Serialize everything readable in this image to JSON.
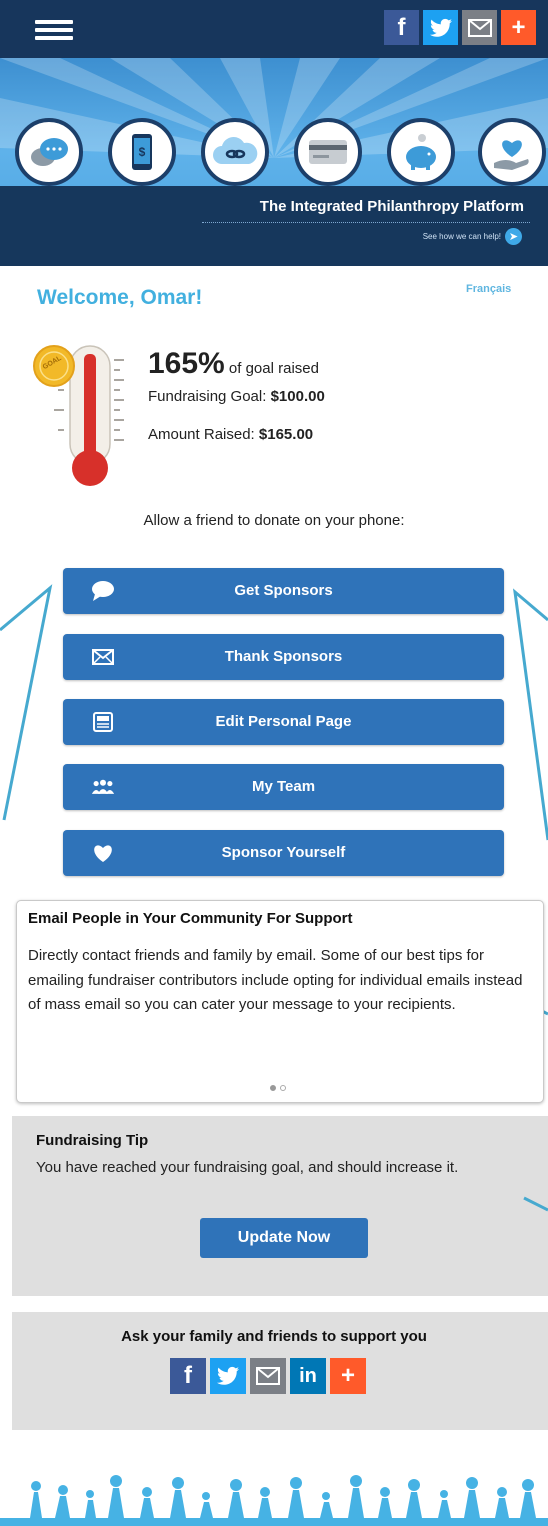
{
  "header": {
    "menu_icon": "hamburger-icon",
    "share_icons": [
      "facebook-icon",
      "twitter-icon",
      "email-icon",
      "plus-icon"
    ]
  },
  "banner": {
    "icons": [
      "chat-bubbles-icon",
      "mobile-phone-icon",
      "cloud-link-icon",
      "credit-card-icon",
      "piggy-bank-icon",
      "heart-hand-icon"
    ],
    "tagline": "The Integrated Philanthropy Platform",
    "see_how": "See how we can help!"
  },
  "welcome": {
    "greeting": "Welcome, Omar!",
    "language_link": "Français"
  },
  "progress": {
    "percent": "165%",
    "percent_suffix": "of goal raised",
    "goal_label": "Fundraising Goal:",
    "goal_value": "$100.00",
    "raised_label": "Amount Raised:",
    "raised_value": "$165.00",
    "fill_fraction": 1.0
  },
  "allow_text": "Allow a friend to donate on your phone:",
  "actions": [
    {
      "label": "Get Sponsors",
      "icon": "speech-bubble-icon"
    },
    {
      "label": "Thank Sponsors",
      "icon": "envelope-icon"
    },
    {
      "label": "Edit Personal Page",
      "icon": "page-icon"
    },
    {
      "label": "My Team",
      "icon": "team-icon"
    },
    {
      "label": "Sponsor Yourself",
      "icon": "heart-icon"
    }
  ],
  "email_card": {
    "title": "Email People in Your Community For Support",
    "body": "Directly contact friends and family by email. Some of our best tips for emailing fundraiser contributors include opting for individual emails instead of mass email so you can cater your message to your recipients.",
    "slides": 2,
    "active_slide": 1
  },
  "tip": {
    "title": "Fundraising Tip",
    "text": "You have reached your fundraising goal, and should increase it.",
    "button": "Update Now"
  },
  "ask": {
    "text": "Ask your family and friends to support you",
    "share_icons": [
      "facebook-icon",
      "twitter-icon",
      "email-icon",
      "linkedin-icon",
      "plus-icon"
    ]
  },
  "colors": {
    "navy": "#17365c",
    "button_blue": "#2f73b9",
    "welcome_blue": "#42b0df",
    "tip_gray": "#dfdfdf"
  }
}
